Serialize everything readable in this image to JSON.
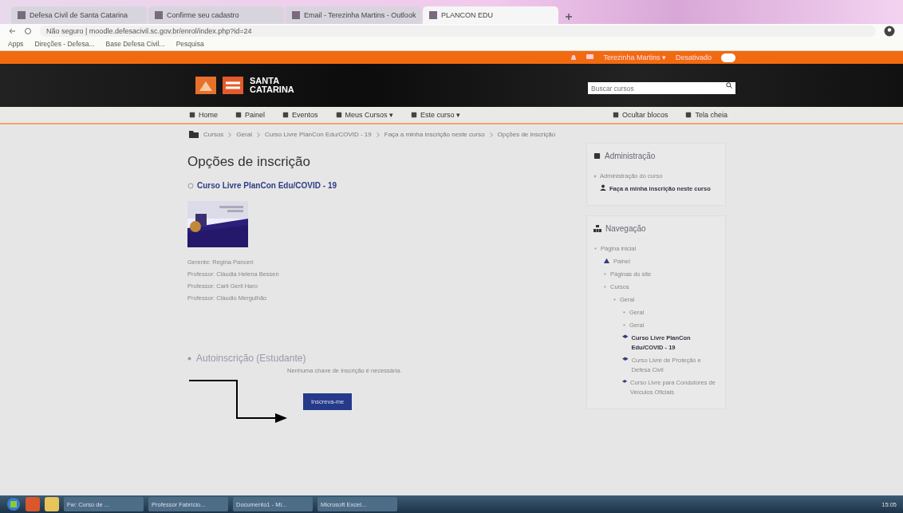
{
  "browser": {
    "tabs": [
      {
        "title": "Defesa Civil de Santa Catarina",
        "selected": false
      },
      {
        "title": "Confirme seu cadastro",
        "selected": false
      },
      {
        "title": "Email - Terezinha Martins - Outlook",
        "selected": false
      },
      {
        "title": "PLANCON EDU",
        "selected": true
      }
    ],
    "address": "Não seguro | moodle.defesacivil.sc.gov.br/enrol/index.php?id=24",
    "bookmarks": [
      "Apps",
      "Direções - Defesa...",
      "Base Defesa Civil...",
      "Pesquisa"
    ]
  },
  "topbar": {
    "user": "Terezinha Martins ▾",
    "edit_mode": "Desativado",
    "edit_on": false
  },
  "header": {
    "logo_top": "SANTA",
    "logo_bottom": "CATARINA",
    "search": {
      "placeholder": "Buscar cursos"
    }
  },
  "navbar": {
    "items": [
      "Home",
      "Painel",
      "Eventos",
      "Meus Cursos ▾",
      "Este curso ▾"
    ],
    "right": [
      "Ocultar blocos",
      "Tela cheia"
    ]
  },
  "breadcrumb": [
    "Cursos",
    "Geral",
    "Curso Livre PlanCon Edu/COVID - 19",
    "Faça a minha inscrição neste curso",
    "Opções de inscrição"
  ],
  "main": {
    "title": "Opções de inscrição",
    "course": "Curso Livre PlanCon Edu/COVID - 19",
    "staff": [
      "Gerente: Regina Panceri",
      "Professor: Cláudia Helena Bessen",
      "Professor: Carli Gerli Haro",
      "Professor: Cláudio Mergulhão"
    ],
    "section": "Autoinscrição (Estudante)",
    "note": "Nenhuma chave de inscrição é necessária.",
    "button": "Inscreva-me"
  },
  "admin": {
    "title": "Administração",
    "group": "Administração do curso",
    "link": "Faça a minha inscrição neste curso"
  },
  "navigation": {
    "title": "Navegação",
    "tree": [
      {
        "label": "Página inicial",
        "kind": "folder",
        "children": [
          {
            "label": "Painel",
            "kind": "dashboard"
          },
          {
            "label": "Páginas do site",
            "kind": "folder"
          },
          {
            "label": "Cursos",
            "kind": "folder",
            "children": [
              {
                "label": "Geral",
                "kind": "folder",
                "children": [
                  {
                    "label": "Geral",
                    "kind": "folder"
                  },
                  {
                    "label": "Geral",
                    "kind": "folder"
                  },
                  {
                    "label": "Curso Livre PlanCon Edu/COVID - 19",
                    "kind": "current"
                  },
                  {
                    "label": "Curso Livre de Proteção e Defesa Civil",
                    "kind": "course"
                  },
                  {
                    "label": "Curso Livre para Condutores de Veículos Oficiais",
                    "kind": "course"
                  }
                ]
              }
            ]
          }
        ]
      }
    ]
  },
  "taskbar": {
    "items": [
      "Fw: Curso de ...",
      "Professor Fabrício...",
      "Documento1 - Mi...",
      "Microsoft Excel..."
    ],
    "time": "15:05"
  }
}
